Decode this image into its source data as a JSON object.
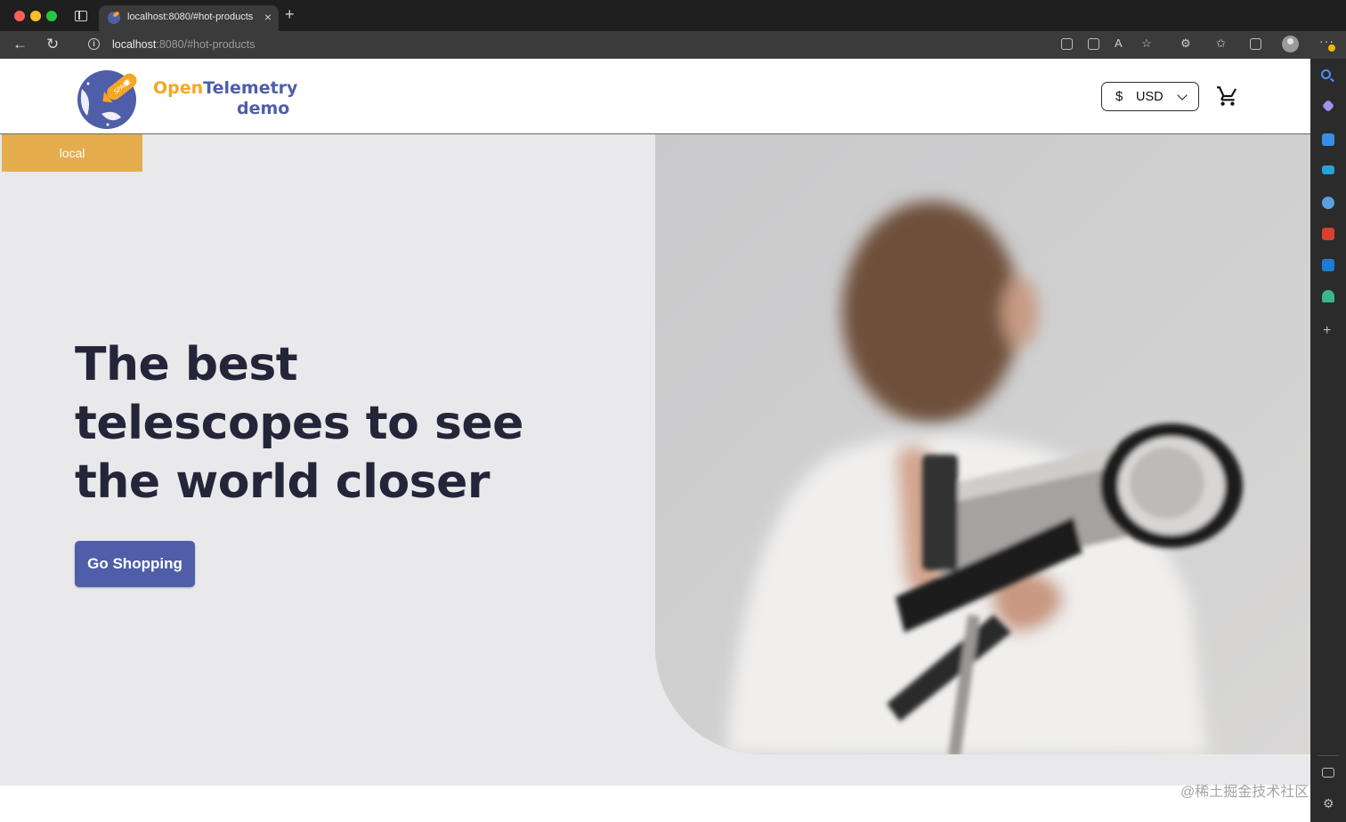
{
  "browser": {
    "tab_title": "localhost:8080/#hot-products",
    "url_host": "localhost",
    "url_rest": ":8080/#hot-products",
    "close_glyph": "×",
    "new_tab_glyph": "+"
  },
  "header": {
    "logo_word_1": "Open",
    "logo_word_2": "Telemetry",
    "logo_word_3": "demo",
    "currency_symbol": "$",
    "currency_value": "USD"
  },
  "hero": {
    "environment_badge": "local",
    "title": "The best telescopes to see the world closer",
    "cta_label": "Go Shopping"
  },
  "watermark": "@稀土掘金技术社区",
  "colors": {
    "brand_blue": "#4f5ea8",
    "brand_orange": "#f5a623",
    "badge": "#e5ad4d",
    "hero_bg": "#e9e9ec",
    "title_text": "#25253a"
  },
  "icons": [
    "back-icon",
    "reload-icon",
    "info-icon",
    "cart-icon",
    "chevron-down-icon",
    "search-icon",
    "sparkle-icon",
    "tag-icon",
    "toolbox-icon",
    "people-icon",
    "office-icon",
    "outlook-icon",
    "tree-icon",
    "plus-icon",
    "settings-icon"
  ]
}
